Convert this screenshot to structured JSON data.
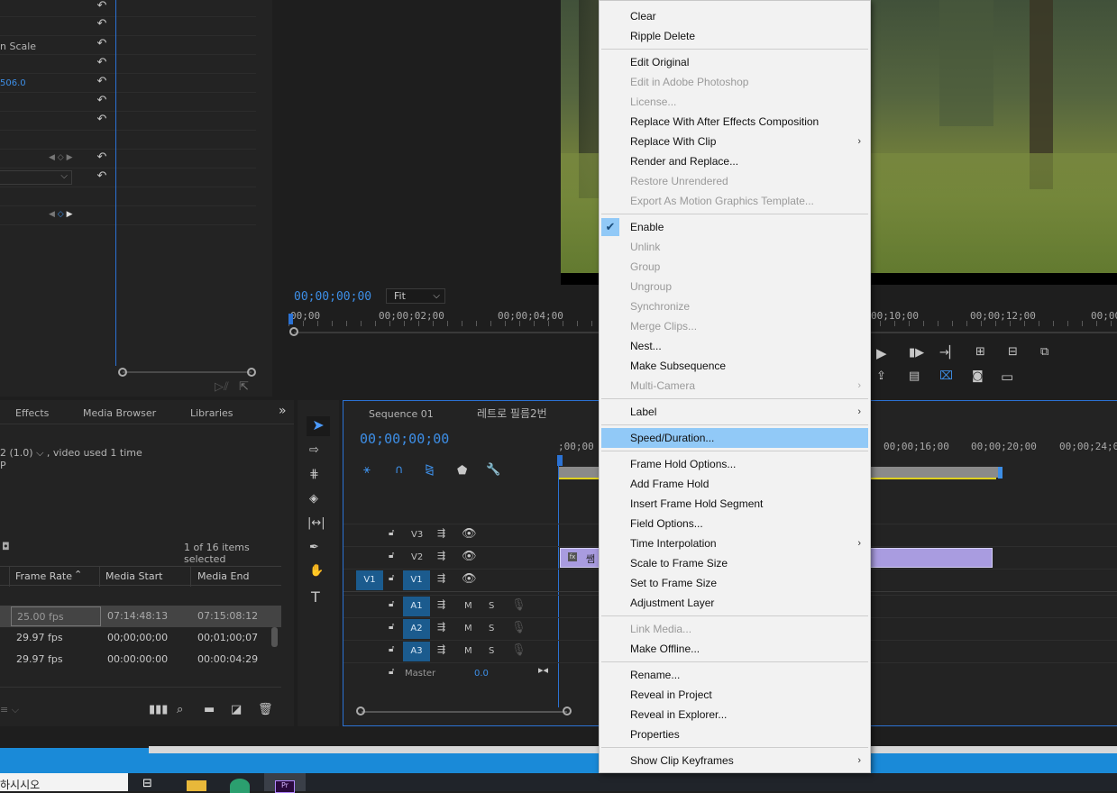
{
  "effect_controls": {
    "scale_label_partial": "n Scale",
    "value_partial": "506.0"
  },
  "program_monitor": {
    "timecode": "00;00;00;00",
    "fit_label": "Fit",
    "ruler": [
      "00;00",
      "00;00;02;00",
      "00;00;04;00",
      "00;10;00",
      "00;00;12;00",
      "00;00"
    ]
  },
  "project_panel": {
    "tabs": [
      "Effects",
      "Media Browser",
      "Libraries"
    ],
    "info_line": "2 (1.0) ⌵ , video used 1 time",
    "info_line2": "P",
    "items_selected": "1 of 16 items selected",
    "columns": [
      "Frame Rate",
      "Media Start",
      "Media End"
    ],
    "rows": [
      {
        "rate": "25.00 fps",
        "start": "07:14:48:13",
        "end": "07:15:08:12"
      },
      {
        "rate": "29.97 fps",
        "start": "00;00;00;00",
        "end": "00;01;00;07"
      },
      {
        "rate": "29.97 fps",
        "start": "00:00:00:00",
        "end": "00:00:04:29"
      }
    ]
  },
  "timeline": {
    "tab1": "Sequence 01",
    "tab2": "레트로 필름2번",
    "timecode": "00;00;00;00",
    "ruler": [
      ";00;00",
      "00;00;16;00",
      "00;00;20;00",
      "00;00;24;00"
    ],
    "tracks": {
      "v3": "V3",
      "v2": "V2",
      "v1": "V1",
      "v1src": "V1",
      "a1": "A1",
      "a2": "A2",
      "a3": "A3",
      "master": "Master",
      "master_val": "0.0",
      "mute": "M",
      "solo": "S"
    },
    "clip_label": "쌤"
  },
  "taskbar": {
    "search_partial": "하시시오"
  },
  "context_menu": {
    "clear": "Clear",
    "ripple_delete": "Ripple Delete",
    "edit_original": "Edit Original",
    "edit_photoshop": "Edit in Adobe Photoshop",
    "license": "License...",
    "replace_ae": "Replace With After Effects Composition",
    "replace_clip": "Replace With Clip",
    "render_replace": "Render and Replace...",
    "restore_unrendered": "Restore Unrendered",
    "export_mgt": "Export As Motion Graphics Template...",
    "enable": "Enable",
    "unlink": "Unlink",
    "group": "Group",
    "ungroup": "Ungroup",
    "synchronize": "Synchronize",
    "merge_clips": "Merge Clips...",
    "nest": "Nest...",
    "make_subsequence": "Make Subsequence",
    "multi_camera": "Multi-Camera",
    "label": "Label",
    "speed_duration": "Speed/Duration...",
    "frame_hold_options": "Frame Hold Options...",
    "add_frame_hold": "Add Frame Hold",
    "insert_frame_hold": "Insert Frame Hold Segment",
    "field_options": "Field Options...",
    "time_interpolation": "Time Interpolation",
    "scale_frame": "Scale to Frame Size",
    "set_frame": "Set to Frame Size",
    "adjustment_layer": "Adjustment Layer",
    "link_media": "Link Media...",
    "make_offline": "Make Offline...",
    "rename": "Rename...",
    "reveal_project": "Reveal in Project",
    "reveal_explorer": "Reveal in Explorer...",
    "properties": "Properties",
    "show_keyframes": "Show Clip Keyframes"
  }
}
